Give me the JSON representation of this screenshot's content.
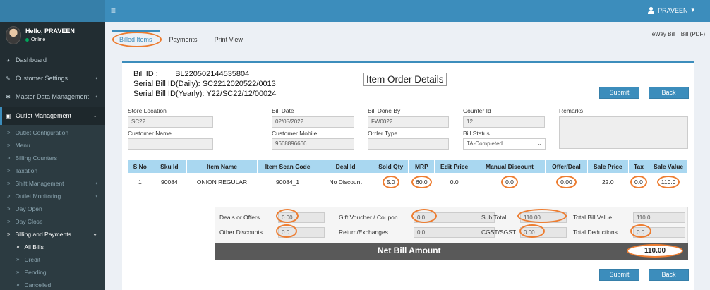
{
  "topbar": {
    "menu_icon": "hamburger-icon",
    "user_name": "PRAVEEN",
    "user_caret": "▾"
  },
  "sidebar": {
    "user": {
      "greeting": "Hello, PRAVEEN",
      "status": "Online"
    },
    "items": [
      {
        "label": "Dashboard",
        "icon": "dashboard-icon"
      },
      {
        "label": "Customer Settings",
        "icon": "wrench-icon"
      },
      {
        "label": "Master Data Management",
        "icon": "gear-icon"
      },
      {
        "label": "Outlet Management",
        "icon": "store-icon"
      }
    ],
    "sub_items": [
      "Outlet Configuration",
      "Menu",
      "Billing Counters",
      "Taxation",
      "Shift Management",
      "Outlet Monitoring",
      "Day Open",
      "Day Close",
      "Billing and Payments",
      "All Bills",
      "Credit",
      "Pending",
      "Cancelled"
    ]
  },
  "tabs": [
    "Billed Items",
    "Payments",
    "Print View"
  ],
  "top_links": [
    "eWay Bill",
    "Bill (PDF)"
  ],
  "bill": {
    "id_label": "Bill ID :",
    "id_value": "BL220502144535804",
    "daily_label": "Serial Bill ID(Daily):",
    "daily_value": "SC2212020522/0013",
    "yearly_label": "Serial Bill ID(Yearly):",
    "yearly_value": "Y22/SC22/12/00024"
  },
  "page_heading": "Item Order Details",
  "buttons": {
    "submit": "Submit",
    "back": "Back"
  },
  "fields": {
    "store_location": {
      "label": "Store Location",
      "value": "SC22"
    },
    "bill_date": {
      "label": "Bill Date",
      "value": "02/05/2022"
    },
    "bill_done_by": {
      "label": "Bill Done By",
      "value": "FW0022"
    },
    "counter_id": {
      "label": "Counter Id",
      "value": "12"
    },
    "remarks": {
      "label": "Remarks",
      "value": ""
    },
    "customer_name": {
      "label": "Customer Name",
      "value": ""
    },
    "customer_mobile": {
      "label": "Customer Mobile",
      "value": "9668896666"
    },
    "order_type": {
      "label": "Order Type",
      "value": ""
    },
    "bill_status": {
      "label": "Bill Status",
      "value": "TA-Completed"
    }
  },
  "table": {
    "headers": [
      "S No",
      "Sku Id",
      "Item Name",
      "Item Scan Code",
      "Deal Id",
      "Sold Qty",
      "MRP",
      "Edit Price",
      "Manual Discount",
      "Offer/Deal",
      "Sale Price",
      "Tax",
      "Sale Value"
    ],
    "rows": [
      [
        "1",
        "90084",
        "ONION REGULAR",
        "90084_1",
        "No Discount",
        "5.0",
        "60.0",
        "0.0",
        "0.0",
        "0.00",
        "22.0",
        "0.0",
        "110.0"
      ]
    ]
  },
  "summary": {
    "deals": {
      "label": "Deals or Offers",
      "value": "0.00"
    },
    "gift": {
      "label": "Gift Voucher / Coupon",
      "value": "0.0"
    },
    "subtotal": {
      "label": "Sub Total",
      "value": "110.00"
    },
    "total_bill": {
      "label": "Total Bill Value",
      "value": "110.0"
    },
    "other_disc": {
      "label": "Other Discounts",
      "value": "0.0"
    },
    "returns": {
      "label": "Return/Exchanges",
      "value": "0.0"
    },
    "gst": {
      "label": "CGST/SGST",
      "value": "0.00"
    },
    "total_ded": {
      "label": "Total Deductions",
      "value": "0.0"
    },
    "net_label": "Net Bill Amount",
    "net_value": "110.00"
  },
  "colors": {
    "accent": "#3c8dbc",
    "highlight": "#ed7d31",
    "sidebar_bg": "#222d32",
    "net_bar": "#595959"
  }
}
